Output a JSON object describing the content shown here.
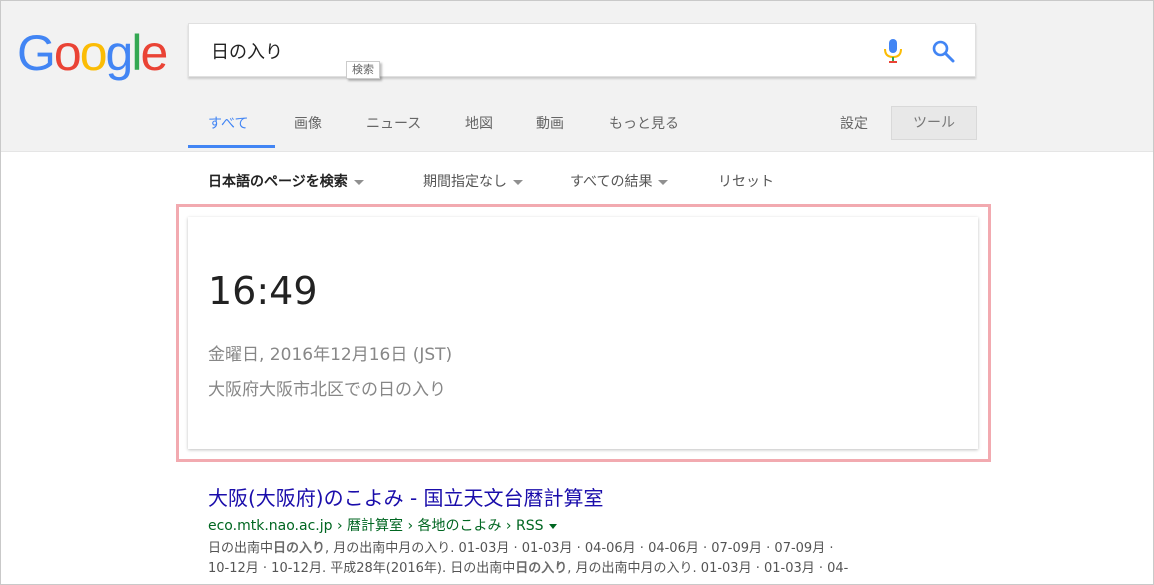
{
  "logo": {
    "letters": [
      "G",
      "o",
      "o",
      "g",
      "l",
      "e"
    ],
    "colors": [
      "#4285f4",
      "#ea4335",
      "#fbbc05",
      "#4285f4",
      "#34a853",
      "#ea4335"
    ]
  },
  "search": {
    "value": "日の入り",
    "tooltip": "検索"
  },
  "tabs": [
    {
      "label": "すべて",
      "active": true
    },
    {
      "label": "画像"
    },
    {
      "label": "ニュース"
    },
    {
      "label": "地図"
    },
    {
      "label": "動画"
    },
    {
      "label": "もっと見る"
    }
  ],
  "settings_label": "設定",
  "tools_label": "ツール",
  "filters": [
    {
      "label": "日本語のページを検索",
      "bold": true
    },
    {
      "label": "期間指定なし"
    },
    {
      "label": "すべての結果"
    },
    {
      "label": "リセット"
    }
  ],
  "answer_card": {
    "time": "16:49",
    "date": "金曜日, 2016年12月16日 (JST)",
    "place": "大阪府大阪市北区での日の入り"
  },
  "result": {
    "title": "大阪(大阪府)のこよみ - 国立天文台暦計算室",
    "url": "eco.mtk.nao.ac.jp › 暦計算室 › 各地のこよみ › RSS",
    "snippet_line1": {
      "pre": "日の出南中",
      "bold": "日の入り",
      "post": ", 月の出南中月の入り. 01-03月 · 01-03月 · 04-06月 · 04-06月 · 07-09月 · 07-09月 ·"
    },
    "snippet_line2": {
      "pre": "10-12月 · 10-12月. 平成28年(2016年). 日の出南中",
      "bold": "日の入り",
      "post": ", 月の出南中月の入り. 01-03月 · 01-03月 · 04-"
    }
  },
  "colors": {
    "accent": "#4285f4",
    "link": "#1a0dab",
    "url": "#006621",
    "highlight_border": "#f2aab0"
  }
}
